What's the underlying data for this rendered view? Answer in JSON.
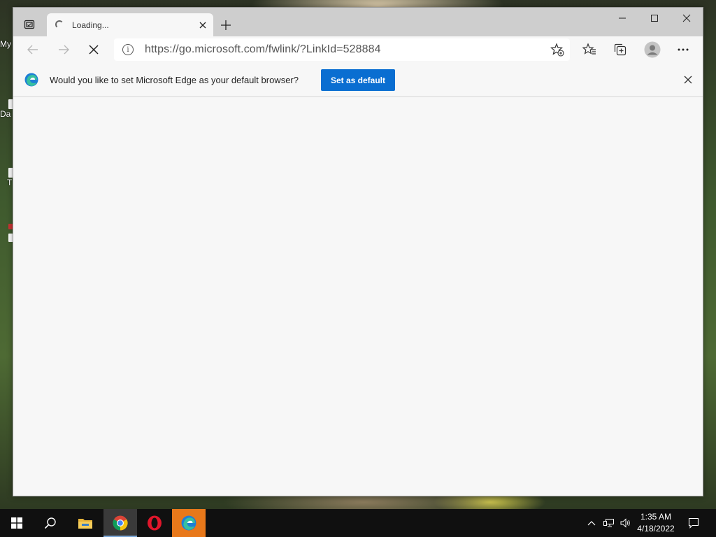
{
  "desktop": {
    "icons": [
      {
        "label": "My"
      },
      {
        "label": "Da"
      },
      {
        "label": "T"
      }
    ]
  },
  "browser": {
    "tab": {
      "title": "Loading..."
    },
    "address_bar": {
      "url": "https://go.microsoft.com/fwlink/?LinkId=528884"
    },
    "infobar": {
      "message": "Would you like to set Microsoft Edge as your default browser?",
      "action_label": "Set as default"
    }
  },
  "taskbar": {
    "apps": [
      {
        "icon": "file-explorer-icon"
      },
      {
        "icon": "chrome-icon"
      },
      {
        "icon": "opera-icon"
      },
      {
        "icon": "edge-icon"
      }
    ],
    "clock": {
      "time": "1:35 AM",
      "date": "4/18/2022"
    }
  },
  "colors": {
    "accent": "#0a6ed1",
    "taskbar_highlight": "#e8781a"
  }
}
